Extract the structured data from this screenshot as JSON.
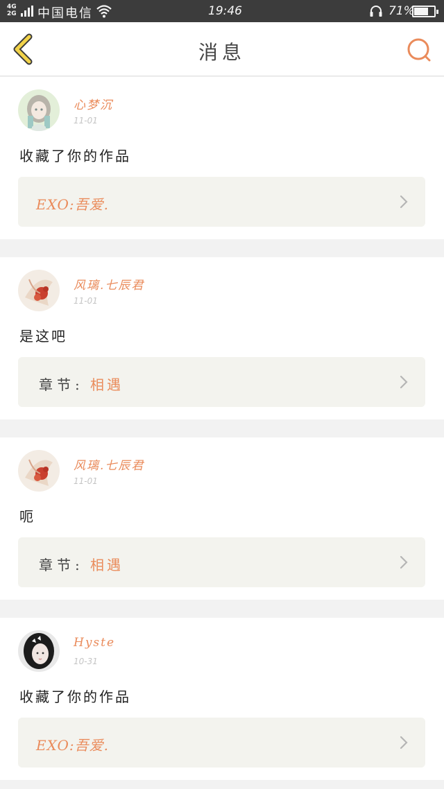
{
  "status_bar": {
    "network": "4G\n2G",
    "carrier": "中国电信",
    "time": "19:46",
    "battery": "71%",
    "battery_level": 0.71
  },
  "nav": {
    "title": "消息",
    "back_icon": "chevron-left-icon",
    "search_icon": "search-icon"
  },
  "colors": {
    "accent": "#ea8b5b",
    "back_yellow": "#f2d34a",
    "card_ref_bg": "#f3f3ee"
  },
  "messages": [
    {
      "name": "心梦沉",
      "date": "11-01",
      "content": "收藏了你的作品",
      "ref_type": "work",
      "work_title": "EXO:吾爱.",
      "avatar": "anime-girl-avatar"
    },
    {
      "name": "风璃.七辰君",
      "date": "11-01",
      "content": "是这吧",
      "ref_type": "chapter",
      "chapter_label": "章节:",
      "chapter_title": "相遇",
      "avatar": "flower-avatar"
    },
    {
      "name": "风璃.七辰君",
      "date": "11-01",
      "content": "呃",
      "ref_type": "chapter",
      "chapter_label": "章节:",
      "chapter_title": "相遇",
      "avatar": "flower-avatar"
    },
    {
      "name": "Hyste",
      "date": "10-31",
      "content": "收藏了你的作品",
      "ref_type": "work",
      "work_title": "EXO:吾爱.",
      "avatar": "girl-photo-avatar"
    }
  ]
}
